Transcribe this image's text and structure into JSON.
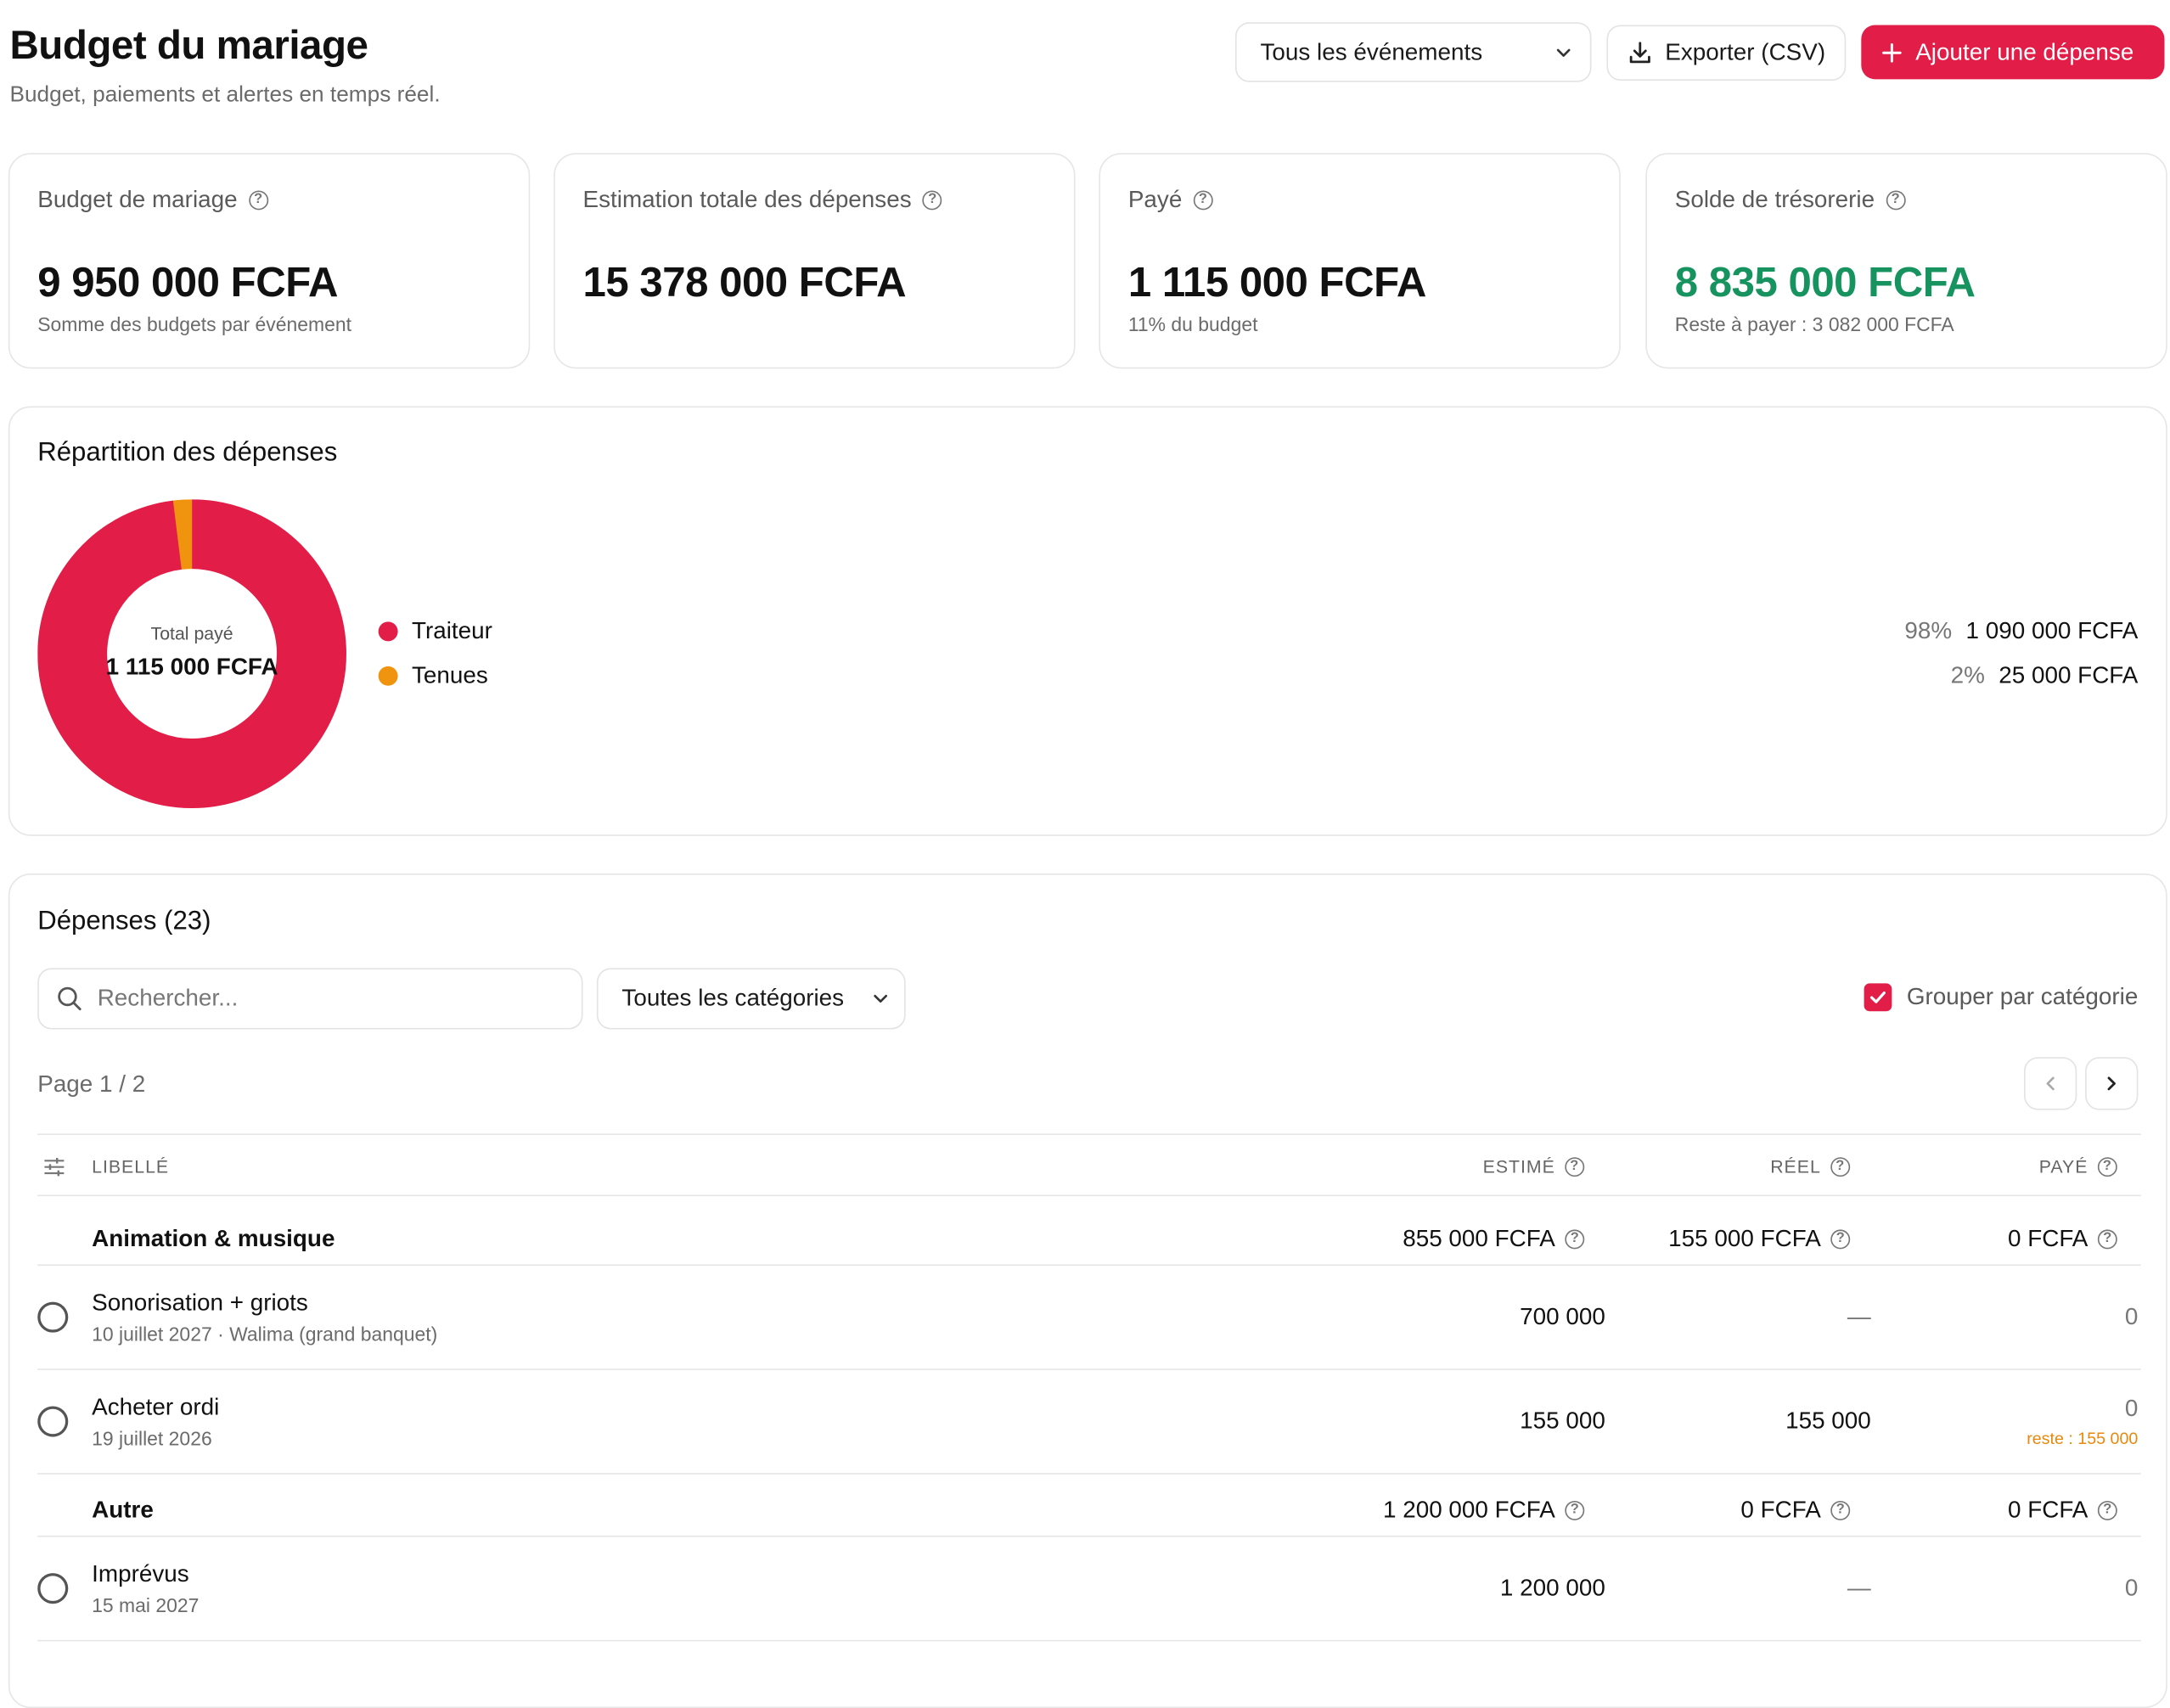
{
  "header": {
    "title": "Budget du mariage",
    "subtitle": "Budget, paiements et alertes en temps réel.",
    "event_filter": "Tous les événements",
    "export_label": "Exporter (CSV)",
    "add_label": "Ajouter une dépense"
  },
  "stats": [
    {
      "label": "Budget de mariage",
      "value": "9 950 000 FCFA",
      "sub": "Somme des budgets par événement"
    },
    {
      "label": "Estimation totale des dépenses",
      "value": "15 378 000 FCFA",
      "sub": ""
    },
    {
      "label": "Payé",
      "value": "1 115 000 FCFA",
      "sub": "11% du budget"
    },
    {
      "label": "Solde de trésorerie",
      "value": "8 835 000 FCFA",
      "sub": "Reste à payer : 3 082 000 FCFA"
    }
  ],
  "repartition": {
    "title": "Répartition des dépenses",
    "center_label": "Total payé",
    "center_value": "1 115 000 FCFA",
    "items": [
      {
        "name": "Traiteur",
        "percent": "98%",
        "amount": "1 090 000 FCFA",
        "color": "#e11d48",
        "fraction": 0.98
      },
      {
        "name": "Tenues",
        "percent": "2%",
        "amount": "25 000 FCFA",
        "color": "#f0930f",
        "fraction": 0.02
      }
    ]
  },
  "expenses": {
    "title": "Dépenses (23)",
    "search_placeholder": "Rechercher...",
    "category_filter": "Toutes les catégories",
    "group_by_label": "Grouper par catégorie",
    "page_label": "Page 1 / 2",
    "columns": {
      "label": "LIBELLÉ",
      "estimated": "ESTIMÉ",
      "real": "RÉEL",
      "paid": "PAYÉ"
    },
    "groups": [
      {
        "name": "Animation & musique",
        "estimated": "855 000 FCFA",
        "real": "155 000 FCFA",
        "paid": "0 FCFA",
        "rows": [
          {
            "title": "Sonorisation + griots",
            "sub": "10 juillet 2027 · Walima (grand banquet)",
            "estimated": "700 000",
            "real": "—",
            "paid": "0",
            "remaining": ""
          },
          {
            "title": "Acheter ordi",
            "sub": "19 juillet 2026",
            "estimated": "155 000",
            "real": "155 000",
            "paid": "0",
            "remaining": "reste : 155 000"
          }
        ]
      },
      {
        "name": "Autre",
        "estimated": "1 200 000 FCFA",
        "real": "0 FCFA",
        "paid": "0 FCFA",
        "rows": [
          {
            "title": "Imprévus",
            "sub": "15 mai 2027",
            "estimated": "1 200 000",
            "real": "—",
            "paid": "0",
            "remaining": ""
          }
        ]
      }
    ]
  },
  "colors": {
    "accent": "#e11d48",
    "positive": "#16935f",
    "warning": "#e8880d",
    "tenues": "#f0930f"
  },
  "icons": [
    "chevron-down-icon",
    "download-icon",
    "plus-icon",
    "help-icon",
    "search-icon",
    "check-icon",
    "chevron-left-icon",
    "chevron-right-icon",
    "sliders-icon",
    "radio-icon"
  ]
}
